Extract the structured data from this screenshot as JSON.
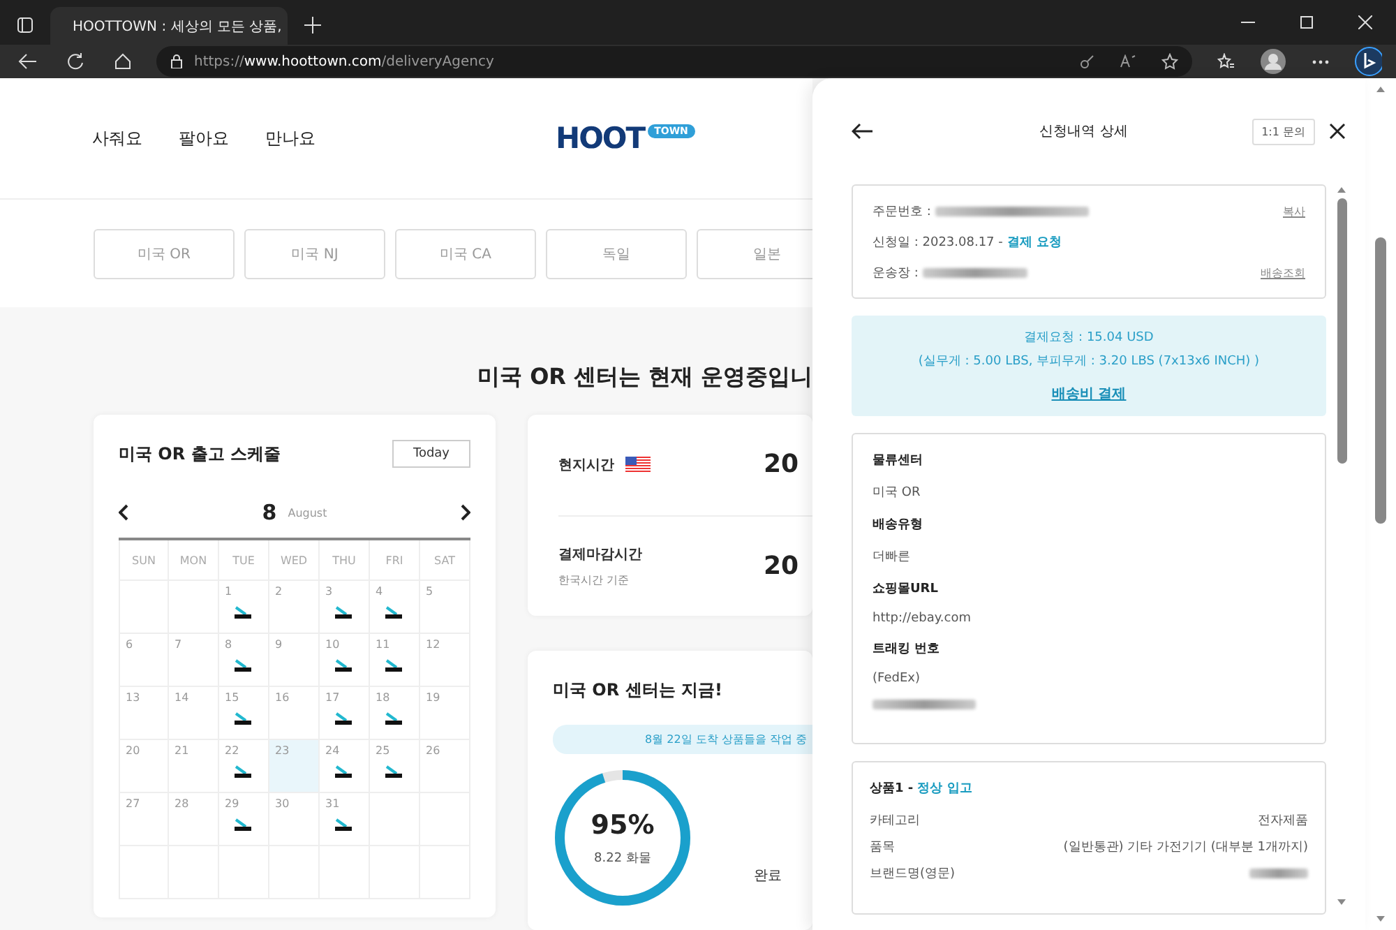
{
  "browser": {
    "tab_title": "HOOTTOWN : 세상의 모든 상품,",
    "url_prefix": "https://",
    "url_host": "www.hoottown.com",
    "url_path": "/deliveryAgency"
  },
  "nav": [
    "사줘요",
    "팔아요",
    "만나요"
  ],
  "logo": {
    "main": "HOOT",
    "badge": "TOWN"
  },
  "center_tabs": [
    "미국 OR",
    "미국 NJ",
    "미국 CA",
    "독일",
    "일본"
  ],
  "status_title": "미국 OR 센터는 현재 운영중입니",
  "calendar": {
    "title": "미국 OR 출고 스케줄",
    "today_button": "Today",
    "month_number": "8",
    "month_name": "August",
    "weekdays": [
      "SUN",
      "MON",
      "TUE",
      "WED",
      "THU",
      "FRI",
      "SAT"
    ],
    "weeks": [
      [
        {
          "day": "1",
          "shipping": true,
          "today": false
        },
        {
          "day": "2",
          "shipping": false,
          "today": false
        },
        {
          "day": "3",
          "shipping": true,
          "today": false
        },
        {
          "day": "4",
          "shipping": true,
          "today": false
        },
        {
          "day": "5",
          "shipping": false,
          "today": false
        }
      ],
      [
        {
          "day": "6",
          "shipping": false,
          "today": false
        },
        {
          "day": "7",
          "shipping": false,
          "today": false
        },
        {
          "day": "8",
          "shipping": true,
          "today": false
        },
        {
          "day": "9",
          "shipping": false,
          "today": false
        },
        {
          "day": "10",
          "shipping": true,
          "today": false
        },
        {
          "day": "11",
          "shipping": true,
          "today": false
        },
        {
          "day": "12",
          "shipping": false,
          "today": false
        }
      ],
      [
        {
          "day": "13",
          "shipping": false,
          "today": false
        },
        {
          "day": "14",
          "shipping": false,
          "today": false
        },
        {
          "day": "15",
          "shipping": true,
          "today": false
        },
        {
          "day": "16",
          "shipping": false,
          "today": false
        },
        {
          "day": "17",
          "shipping": true,
          "today": false
        },
        {
          "day": "18",
          "shipping": true,
          "today": false
        },
        {
          "day": "19",
          "shipping": false,
          "today": false
        }
      ],
      [
        {
          "day": "20",
          "shipping": false,
          "today": false
        },
        {
          "day": "21",
          "shipping": false,
          "today": false
        },
        {
          "day": "22",
          "shipping": true,
          "today": false
        },
        {
          "day": "23",
          "shipping": false,
          "today": true
        },
        {
          "day": "24",
          "shipping": true,
          "today": false
        },
        {
          "day": "25",
          "shipping": true,
          "today": false
        },
        {
          "day": "26",
          "shipping": false,
          "today": false
        }
      ],
      [
        {
          "day": "27",
          "shipping": false,
          "today": false
        },
        {
          "day": "28",
          "shipping": false,
          "today": false
        },
        {
          "day": "29",
          "shipping": true,
          "today": false
        },
        {
          "day": "30",
          "shipping": false,
          "today": false
        },
        {
          "day": "31",
          "shipping": true,
          "today": false
        }
      ]
    ]
  },
  "times": [
    {
      "label": "현지시간",
      "flag": true,
      "value": "20"
    },
    {
      "label": "결제마감시간",
      "note": "한국시간 기준",
      "flag": false,
      "value": "20"
    }
  ],
  "center_now": {
    "title": "미국 OR 센터는 지금!",
    "bubble": "8월 22일 도착 상품들을 작업 중",
    "level": 0.95,
    "percent": "95%",
    "caption": "8.22 화물",
    "side_label": "완료"
  },
  "drawer": {
    "title": "신청내역 상세",
    "inquiry_button": "1:1 문의",
    "order_rows": [
      {
        "label": "주문번호 :",
        "kind": "masked",
        "link": "복사"
      },
      {
        "label": "신청일 : 2023.08.17 -",
        "kind": "status",
        "status": "결제 요청"
      },
      {
        "label": "운송장 :",
        "kind": "masked",
        "link": "배송조회"
      }
    ],
    "payment": {
      "amount": "결제요청 : 15.04 USD",
      "weights": "(실무게 : 5.00 LBS, 부피무게 : 3.20 LBS (7x13x6 INCH) )",
      "link": "배송비 결제"
    },
    "info": [
      {
        "label": "물류센터",
        "value": "미국 OR",
        "masked": false
      },
      {
        "label": "배송유형",
        "value": "더빠른",
        "masked": false
      },
      {
        "label": "쇼핑몰URL",
        "value": "http://ebay.com",
        "masked": false
      },
      {
        "label": "트래킹 번호",
        "value": "(FedEx)",
        "masked": true
      }
    ],
    "product": {
      "title": "상품1 -",
      "status": "정상 입고",
      "rows": [
        {
          "label": "카테고리",
          "value": "전자제품",
          "masked": false
        },
        {
          "label": "품목",
          "value": "(일반통관) 기타 가전기기 (대부분 1개까지)",
          "masked": false
        },
        {
          "label": "브랜드명(영문)",
          "masked": true
        }
      ]
    }
  }
}
